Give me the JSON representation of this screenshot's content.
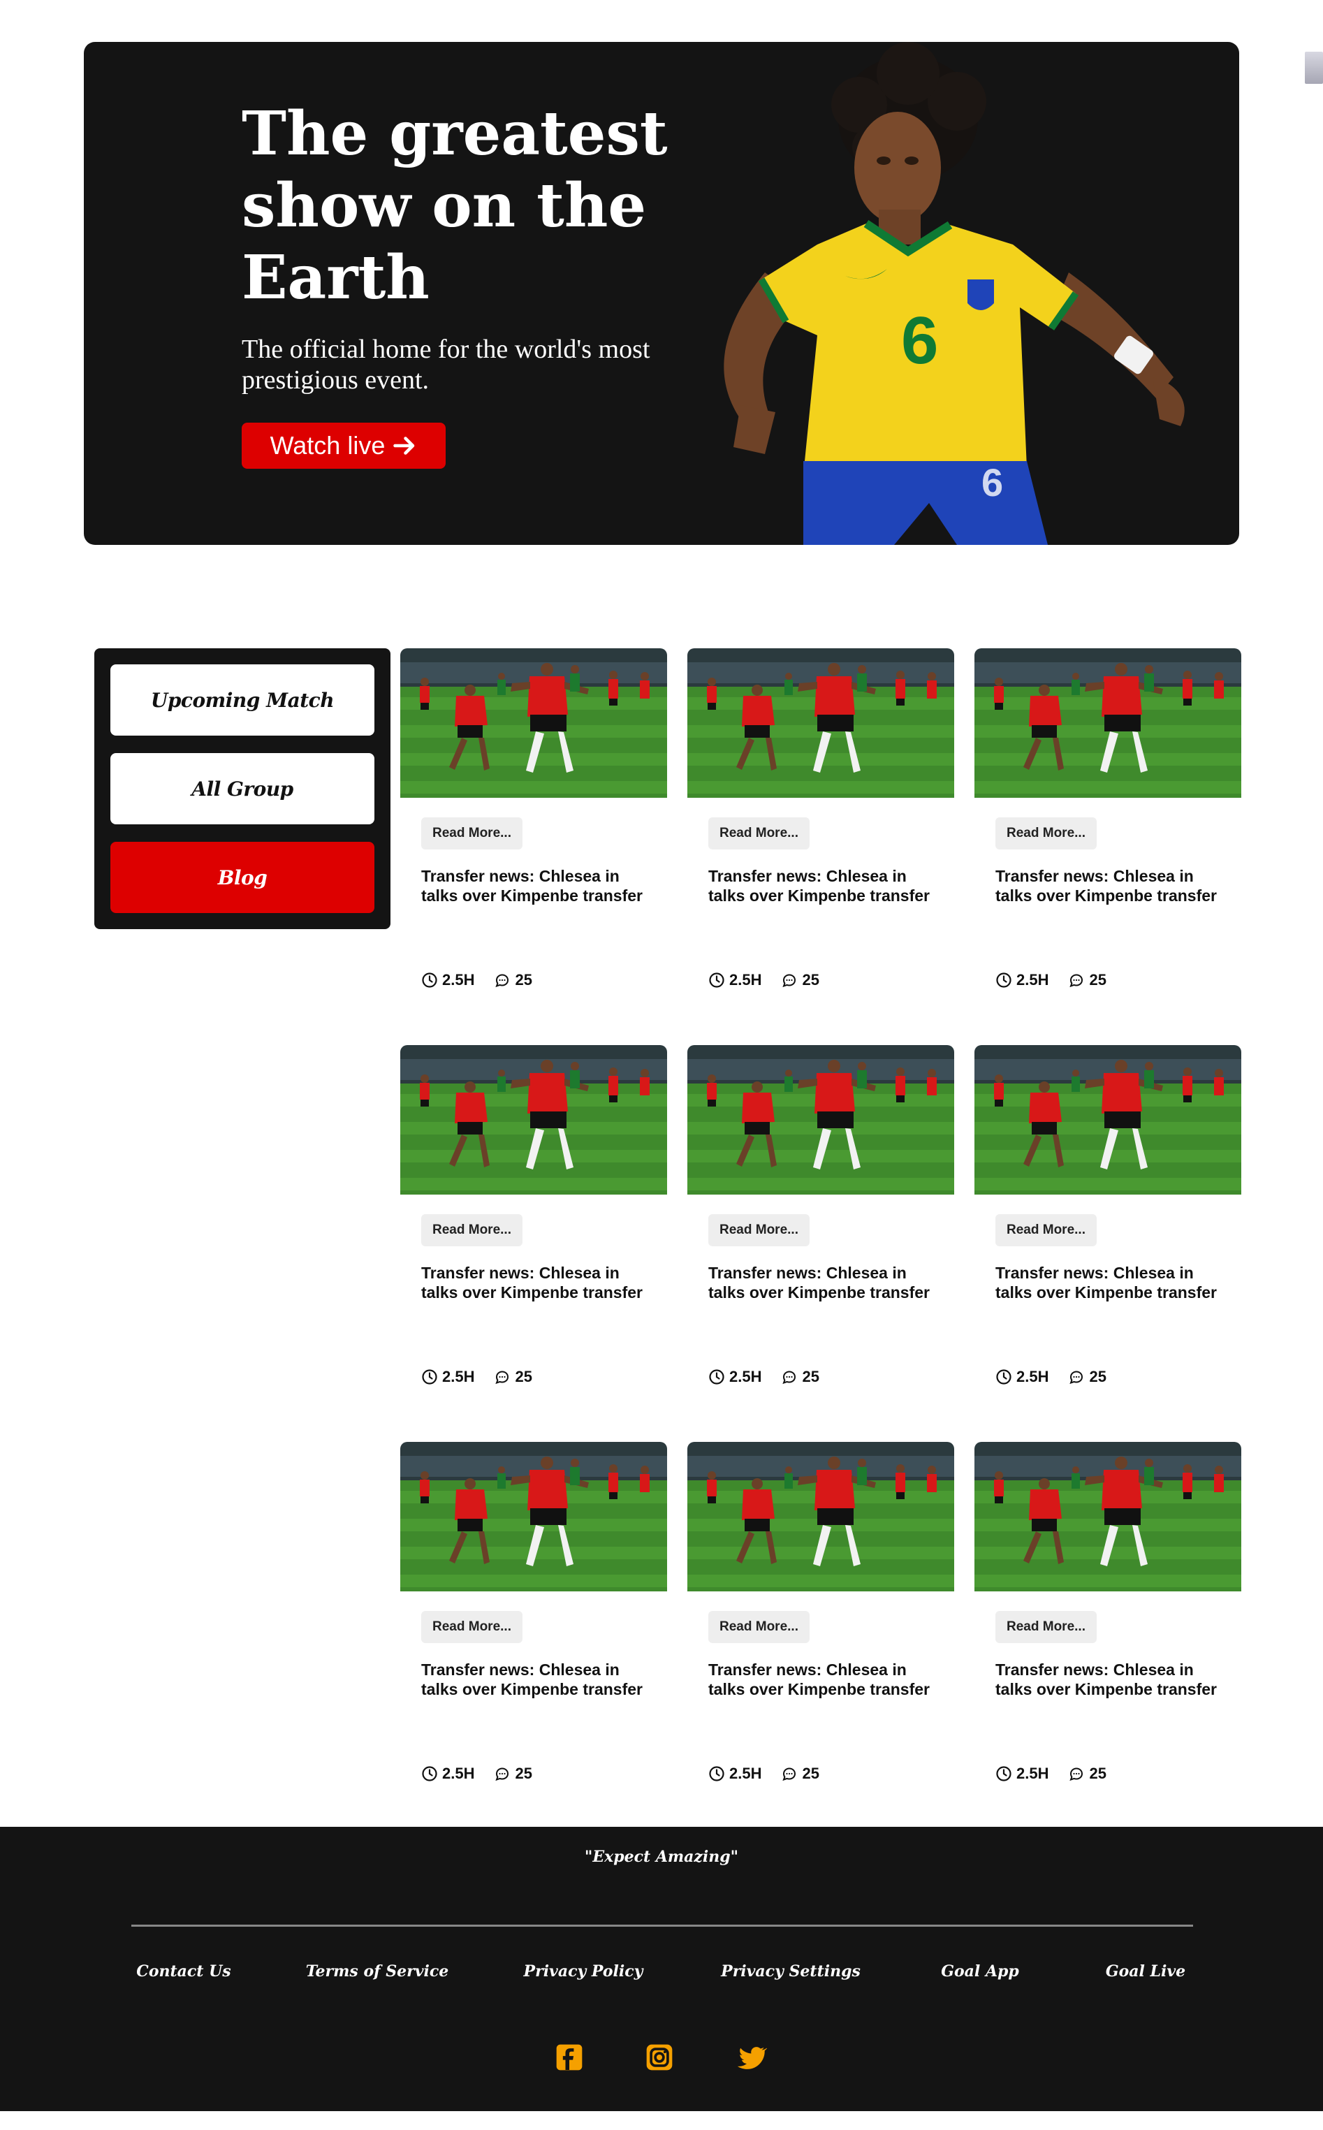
{
  "hero": {
    "title": "The greatest show on the Earth",
    "subtitle": "The official home for the world's most prestigious event.",
    "cta_label": "Watch live",
    "cta_icon": "arrow-right-icon",
    "player_jersey_number": "6"
  },
  "sidebar": {
    "items": [
      {
        "label": "Upcoming Match",
        "active": false
      },
      {
        "label": "All Group",
        "active": false
      },
      {
        "label": "Blog",
        "active": true
      }
    ]
  },
  "cards": [
    {
      "read_more": "Read More...",
      "title": "Transfer news: Chlesea in talks over Kimpenbe transfer",
      "time": "2.5H",
      "comments": "25"
    },
    {
      "read_more": "Read More...",
      "title": "Transfer news: Chlesea in talks over Kimpenbe transfer",
      "time": "2.5H",
      "comments": "25"
    },
    {
      "read_more": "Read More...",
      "title": "Transfer news: Chlesea in talks over Kimpenbe transfer",
      "time": "2.5H",
      "comments": "25"
    },
    {
      "read_more": "Read More...",
      "title": "Transfer news: Chlesea in talks over Kimpenbe transfer",
      "time": "2.5H",
      "comments": "25"
    },
    {
      "read_more": "Read More...",
      "title": "Transfer news: Chlesea in talks over Kimpenbe transfer",
      "time": "2.5H",
      "comments": "25"
    },
    {
      "read_more": "Read More...",
      "title": "Transfer news: Chlesea in talks over Kimpenbe transfer",
      "time": "2.5H",
      "comments": "25"
    },
    {
      "read_more": "Read More...",
      "title": "Transfer news: Chlesea in talks over Kimpenbe transfer",
      "time": "2.5H",
      "comments": "25"
    },
    {
      "read_more": "Read More...",
      "title": "Transfer news: Chlesea in talks over Kimpenbe transfer",
      "time": "2.5H",
      "comments": "25"
    },
    {
      "read_more": "Read More...",
      "title": "Transfer news: Chlesea in talks over Kimpenbe transfer",
      "time": "2.5H",
      "comments": "25"
    }
  ],
  "card_icons": {
    "time": "clock-icon",
    "comments": "comment-icon"
  },
  "footer": {
    "tagline": "\"Expect Amazing\"",
    "links": [
      "Contact Us",
      "Terms of Service",
      "Privacy Policy",
      "Privacy Settings",
      "Goal App",
      "Goal Live"
    ],
    "social": [
      "facebook-icon",
      "instagram-icon",
      "twitter-icon"
    ]
  },
  "colors": {
    "accent_red": "#dd0000",
    "dark_bg": "#141414",
    "social_orange": "#f5a000",
    "jersey_yellow": "#f3d21c",
    "shorts_blue": "#1f44b8"
  }
}
